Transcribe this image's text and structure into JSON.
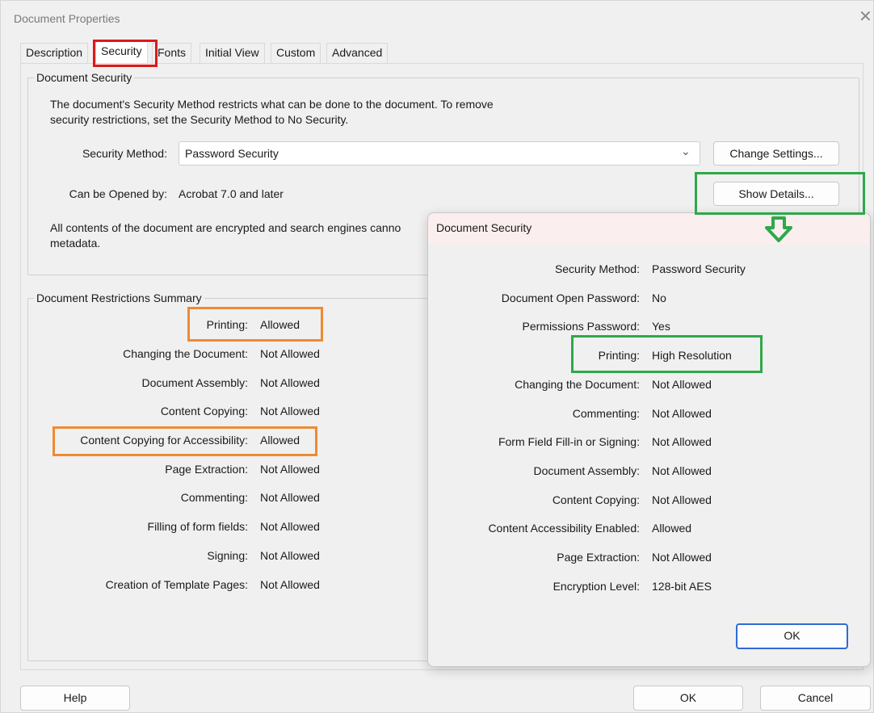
{
  "window": {
    "title": "Document Properties",
    "close_glyph": "✕"
  },
  "tabs": [
    {
      "label": "Description"
    },
    {
      "label": "Security"
    },
    {
      "label": "Fonts"
    },
    {
      "label": "Initial View"
    },
    {
      "label": "Custom"
    },
    {
      "label": "Advanced"
    }
  ],
  "security_group": {
    "label": "Document Security",
    "intro_line1": "The document's Security Method restricts what can be done to the document. To remove",
    "intro_line2": "security restrictions, set the Security Method to No Security.",
    "method_label": "Security Method:",
    "method_value": "Password Security",
    "change_settings_label": "Change Settings...",
    "opened_by_label": "Can be Opened by:",
    "opened_by_value": "Acrobat 7.0 and later",
    "show_details_label": "Show Details...",
    "encrypted_line1": "All contents of the document are encrypted and search engines canno",
    "encrypted_line2": "metadata."
  },
  "restrictions": {
    "label": "Document Restrictions Summary",
    "rows": [
      {
        "label": "Printing:",
        "value": "Allowed"
      },
      {
        "label": "Changing the Document:",
        "value": "Not Allowed"
      },
      {
        "label": "Document Assembly:",
        "value": "Not Allowed"
      },
      {
        "label": "Content Copying:",
        "value": "Not Allowed"
      },
      {
        "label": "Content Copying for Accessibility:",
        "value": "Allowed"
      },
      {
        "label": "Page Extraction:",
        "value": "Not Allowed"
      },
      {
        "label": "Commenting:",
        "value": "Not Allowed"
      },
      {
        "label": "Filling of form fields:",
        "value": "Not Allowed"
      },
      {
        "label": "Signing:",
        "value": "Not Allowed"
      },
      {
        "label": "Creation of Template Pages:",
        "value": "Not Allowed"
      }
    ]
  },
  "footer": {
    "help_label": "Help",
    "ok_label": "OK",
    "cancel_label": "Cancel"
  },
  "popup": {
    "title": "Document Security",
    "rows": [
      {
        "label": "Security Method:",
        "value": "Password Security"
      },
      {
        "label": "Document Open Password:",
        "value": "No"
      },
      {
        "label": "Permissions Password:",
        "value": "Yes"
      },
      {
        "label": "Printing:",
        "value": "High Resolution"
      },
      {
        "label": "Changing the Document:",
        "value": "Not Allowed"
      },
      {
        "label": "Commenting:",
        "value": "Not Allowed"
      },
      {
        "label": "Form Field Fill-in or Signing:",
        "value": "Not Allowed"
      },
      {
        "label": "Document Assembly:",
        "value": "Not Allowed"
      },
      {
        "label": "Content Copying:",
        "value": "Not Allowed"
      },
      {
        "label": "Content Accessibility Enabled:",
        "value": "Allowed"
      },
      {
        "label": "Page Extraction:",
        "value": "Not Allowed"
      },
      {
        "label": "Encryption Level:",
        "value": "128-bit AES"
      }
    ],
    "ok_label": "OK"
  },
  "annotations": {
    "red": "#e01717",
    "orange": "#ee8a35",
    "green": "#2fa84a",
    "arrow_icon": "down-arrow-icon"
  }
}
